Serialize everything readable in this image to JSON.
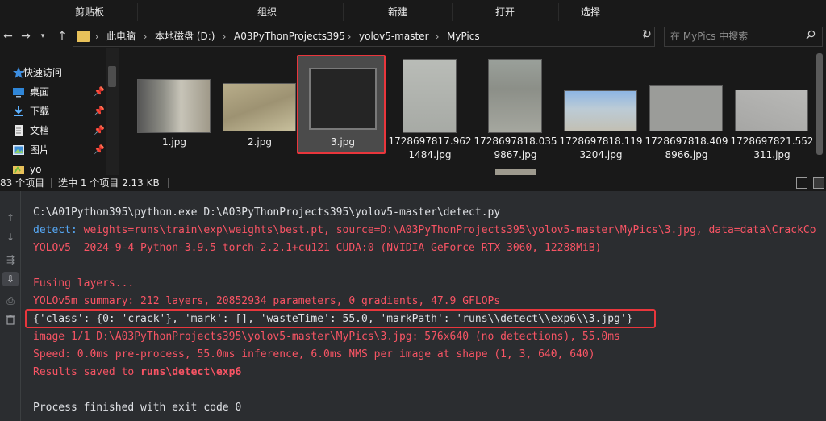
{
  "ribbon": {
    "groups": [
      "剪贴板",
      "组织",
      "新建",
      "打开",
      "选择"
    ]
  },
  "nav": {
    "back_icon": "left-arrow",
    "forward_icon": "right-arrow",
    "recent_icon": "chevron-down",
    "up_icon": "up-arrow",
    "breadcrumb": [
      "此电脑",
      "本地磁盘 (D:)",
      "A03PyThonProjects395",
      "yolov5-master",
      "MyPics"
    ],
    "refresh_icon": "refresh",
    "search_placeholder": "在 MyPics 中搜索"
  },
  "sidebar": {
    "items": [
      {
        "label": "快速访问",
        "icon": "star-icon",
        "pinned": false
      },
      {
        "label": "桌面",
        "icon": "desktop-icon",
        "pinned": true
      },
      {
        "label": "下载",
        "icon": "download-icon",
        "pinned": true
      },
      {
        "label": "文档",
        "icon": "document-icon",
        "pinned": true
      },
      {
        "label": "图片",
        "icon": "pictures-icon",
        "pinned": true
      },
      {
        "label": "yo",
        "icon": "folder-icon",
        "pinned": false
      }
    ],
    "pin_glyph": "📌"
  },
  "files": [
    {
      "name": "1.jpg",
      "selected": false
    },
    {
      "name": "2.jpg",
      "selected": false
    },
    {
      "name": "3.jpg",
      "selected": true
    },
    {
      "name": "1728697817.9621484.jpg",
      "selected": false
    },
    {
      "name": "1728697818.0359867.jpg",
      "selected": false
    },
    {
      "name": "1728697818.1193204.jpg",
      "selected": false
    },
    {
      "name": "1728697818.4098966.jpg",
      "selected": false
    },
    {
      "name": "1728697821.552311.jpg",
      "selected": false
    }
  ],
  "status": {
    "count": "83 个项目",
    "selection": "选中 1 个项目  2.13 KB"
  },
  "console": {
    "lines": [
      {
        "text": "C:\\A01Python395\\python.exe D:\\A03PyThonProjects395\\yolov5-master\\detect.py",
        "style": "plain"
      },
      {
        "prefix": "detect: ",
        "text": "weights=runs\\train\\exp\\weights\\best.pt, source=D:\\A03PyThonProjects395\\yolov5-master\\MyPics\\3.jpg, data=data\\CrackCo",
        "style": "red-blue"
      },
      {
        "text": "YOLOv5  2024-9-4 Python-3.9.5 torch-2.2.1+cu121 CUDA:0 (NVIDIA GeForce RTX 3060, 12288MiB)",
        "style": "red"
      },
      {
        "text": "",
        "style": "plain"
      },
      {
        "text": "Fusing layers...",
        "style": "red"
      },
      {
        "text": "YOLOv5m summary: 212 layers, 20852934 parameters, 0 gradients, 47.9 GFLOPs",
        "style": "red"
      },
      {
        "text": "{'class': {0: 'crack'}, 'mark': [], 'wasteTime': 55.0, 'markPath': 'runs\\\\detect\\\\exp6\\\\3.jpg'}",
        "style": "plain"
      },
      {
        "text": "image 1/1 D:\\A03PyThonProjects395\\yolov5-master\\MyPics\\3.jpg: 576x640 (no detections), 55.0ms",
        "style": "red"
      },
      {
        "text": "Speed: 0.0ms pre-process, 55.0ms inference, 6.0ms NMS per image at shape (1, 3, 640, 640)",
        "style": "red"
      },
      {
        "prefix": "Results saved to ",
        "text": "runs\\detect\\exp6",
        "style": "red-bold"
      },
      {
        "text": "",
        "style": "plain"
      },
      {
        "text": "Process finished with exit code 0",
        "style": "plain"
      }
    ],
    "gutter_icons": [
      "up-arrow-icon",
      "down-arrow-icon",
      "soft-wrap-icon",
      "scroll-to-end-icon",
      "print-icon",
      "trash-icon"
    ]
  },
  "colors": {
    "background": "#191919",
    "console_bg": "#2b2d30",
    "selection_border": "#e9363c",
    "error_red": "#f75464",
    "link_blue": "#56a8f5"
  }
}
